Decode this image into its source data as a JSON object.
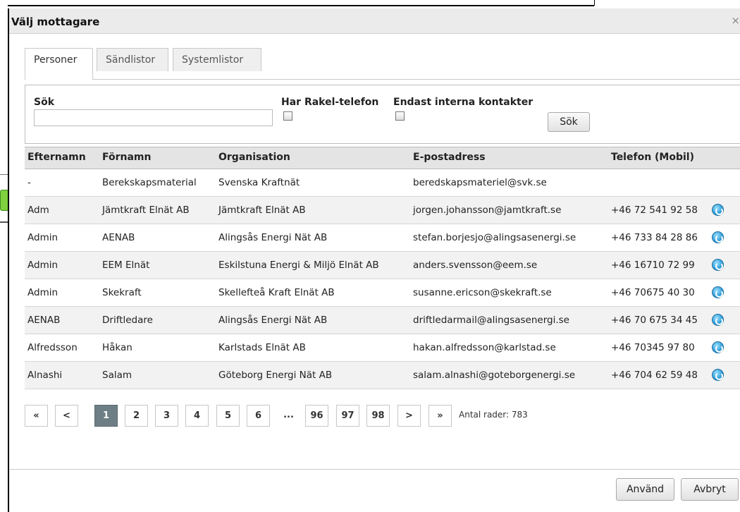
{
  "dialog": {
    "title": "Välj mottagare",
    "close_label": "×"
  },
  "tabs": [
    {
      "label": "Personer",
      "active": true
    },
    {
      "label": "Sändlistor",
      "active": false
    },
    {
      "label": "Systemlistor",
      "active": false
    }
  ],
  "search": {
    "label": "Sök",
    "value": "",
    "rakel_label": "Har Rakel-telefon",
    "rakel_checked": false,
    "internal_label": "Endast interna kontakter",
    "internal_checked": false,
    "button_label": "Sök"
  },
  "table": {
    "columns": [
      "Efternamn",
      "Förnamn",
      "Organisation",
      "E-postadress",
      "Telefon (Mobil)"
    ],
    "rows": [
      {
        "efternamn": "-",
        "fornamn": "Berekskapsmaterial",
        "organisation": "Svenska Kraftnät",
        "epost": "beredskapsmateriel@svk.se",
        "telefon": "",
        "icon": false
      },
      {
        "efternamn": "Adm",
        "fornamn": "Jämtkraft Elnät AB",
        "organisation": "Jämtkraft Elnät AB",
        "epost": "jorgen.johansson@jamtkraft.se",
        "telefon": "+46 72 541 92 58",
        "icon": true
      },
      {
        "efternamn": "Admin",
        "fornamn": "AENAB",
        "organisation": "Alingsås Energi Nät AB",
        "epost": "stefan.borjesjo@alingsasenergi.se",
        "telefon": "+46 733 84 28 86",
        "icon": true
      },
      {
        "efternamn": "Admin",
        "fornamn": "EEM Elnät",
        "organisation": "Eskilstuna Energi & Miljö Elnät AB",
        "epost": "anders.svensson@eem.se",
        "telefon": "+46 16710 72 99",
        "icon": true
      },
      {
        "efternamn": "Admin",
        "fornamn": "Skekraft",
        "organisation": "Skellefteå Kraft Elnät AB",
        "epost": "susanne.ericson@skekraft.se",
        "telefon": "+46 70675 40 30",
        "icon": true
      },
      {
        "efternamn": "AENAB",
        "fornamn": "Driftledare",
        "organisation": "Alingsås Energi Nät AB",
        "epost": "driftledarmail@alingsasenergi.se",
        "telefon": "+46 70 675 34 45",
        "icon": true
      },
      {
        "efternamn": "Alfredsson",
        "fornamn": "Håkan",
        "organisation": "Karlstads Elnät AB",
        "epost": "hakan.alfredsson@karlstad.se",
        "telefon": "+46 70345 97 80",
        "icon": true
      },
      {
        "efternamn": "Alnashi",
        "fornamn": "Salam",
        "organisation": "Göteborg Energi Nät AB",
        "epost": "salam.alnashi@goteborgenergi.se",
        "telefon": "+46 704 62 59 48",
        "icon": true
      }
    ]
  },
  "pagination": {
    "items": [
      "«",
      "<",
      "1",
      "2",
      "3",
      "4",
      "5",
      "6",
      "...",
      "96",
      "97",
      "98",
      ">",
      "»"
    ],
    "current": "1",
    "row_count_text": "Antal rader: 783"
  },
  "footer": {
    "apply_label": "Använd",
    "cancel_label": "Avbryt"
  },
  "colors": {
    "header_bg": "#e4e4e4",
    "active_page": "#6d7e84",
    "phone_icon": "#1c8fd1"
  }
}
